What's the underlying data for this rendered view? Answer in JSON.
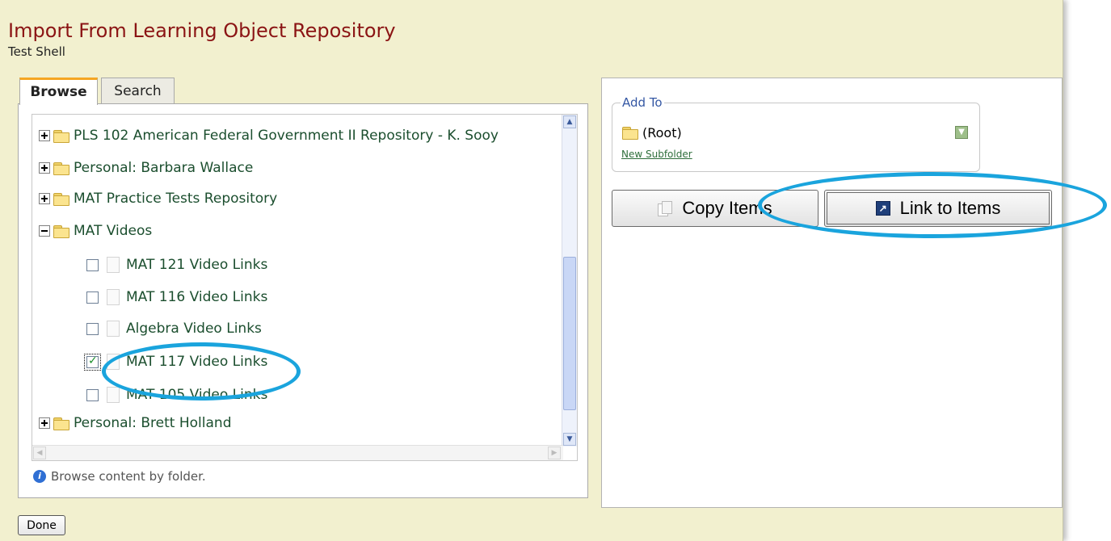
{
  "header": {
    "title": "Import From Learning Object Repository",
    "subtitle": "Test Shell"
  },
  "tabs": {
    "browse_label": "Browse",
    "search_label": "Search"
  },
  "tree": {
    "items": [
      {
        "label": "PLS 102 American Federal Government II Repository - K. Sooy",
        "type": "folder",
        "expanded": false
      },
      {
        "label": "Personal: Barbara Wallace",
        "type": "folder",
        "expanded": false
      },
      {
        "label": "MAT Practice Tests Repository",
        "type": "folder",
        "expanded": false
      },
      {
        "label": "MAT Videos",
        "type": "folder",
        "expanded": true
      },
      {
        "label": "MAT 121 Video Links",
        "type": "document",
        "checked": false
      },
      {
        "label": "MAT 116 Video Links",
        "type": "document",
        "checked": false
      },
      {
        "label": "Algebra Video Links",
        "type": "document",
        "checked": false
      },
      {
        "label": "MAT 117 Video Links",
        "type": "document",
        "checked": true
      },
      {
        "label": "MAT 105 Video Links",
        "type": "document",
        "checked": false
      },
      {
        "label": "Personal: Brett Holland",
        "type": "folder",
        "expanded": false
      }
    ],
    "hint": "Browse content by folder."
  },
  "add_to": {
    "legend": "Add To",
    "selected_folder": "(Root)",
    "new_subfolder_link": "New Subfolder"
  },
  "actions": {
    "copy_label": "Copy Items",
    "link_label": "Link to Items",
    "done_label": "Done"
  },
  "colors": {
    "background": "#f2f0cf",
    "title": "#8b1414",
    "tree_text": "#1b4e2e",
    "annotation_highlight": "#1aa4dd",
    "active_tab_accent": "#f5a623"
  },
  "icons": [
    "plus-expander-icon",
    "minus-expander-icon",
    "folder-icon",
    "document-icon",
    "checkbox-icon",
    "info-icon",
    "copy-icon",
    "link-icon",
    "dropdown-arrow-icon",
    "scroll-up-icon",
    "scroll-down-icon",
    "scroll-left-icon",
    "scroll-right-icon"
  ]
}
